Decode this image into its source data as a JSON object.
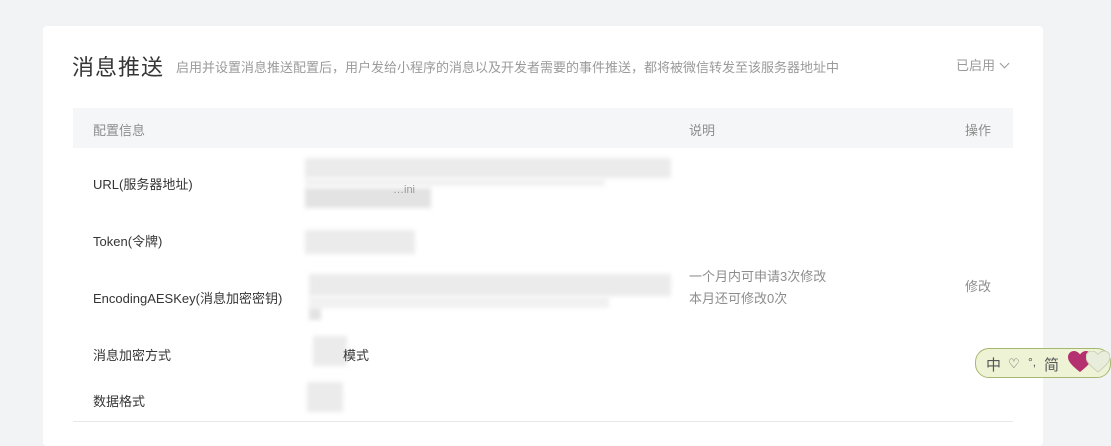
{
  "header": {
    "title": "消息推送",
    "description": "启用并设置消息推送配置后，用户发给小程序的消息以及开发者需要的事件推送，都将被微信转发至该服务器地址中",
    "status": "已启用"
  },
  "table": {
    "columns": {
      "config": "配置信息",
      "description": "说明",
      "operation": "操作"
    },
    "rows": {
      "url": {
        "label": "URL(服务器地址)",
        "fragment": "…ini"
      },
      "token": {
        "label": "Token(令牌)"
      },
      "aeskey": {
        "label": "EncodingAESKey(消息加密密钥)",
        "note_line1": "一个月内可申请3次修改",
        "note_line2": "本月还可修改0次",
        "action": "修改"
      },
      "encrypt_mode": {
        "label": "消息加密方式",
        "value_fragment": "模式"
      },
      "data_format": {
        "label": "数据格式"
      }
    }
  },
  "ime": {
    "lang": "中",
    "symbol": "♡",
    "punct": "°,",
    "mode": "简"
  },
  "colors": {
    "card_bg": "#ffffff",
    "page_bg": "#f2f3f5",
    "muted_text": "#8d8d8d",
    "header_bg": "#f5f6f7"
  }
}
